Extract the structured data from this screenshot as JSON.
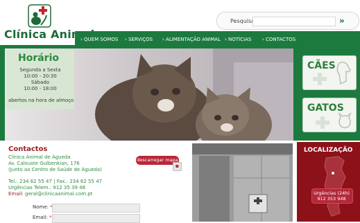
{
  "brand": {
    "name": "Clínica Animal"
  },
  "search": {
    "label": "Pesquisa",
    "go": "»"
  },
  "nav": {
    "items": [
      {
        "label": "› QUEM SOMOS"
      },
      {
        "label": "› SERVIÇOS"
      },
      {
        "label": "› ALIMENTAÇÃO ANIMAL"
      },
      {
        "label": "› NOTÍCIAS"
      },
      {
        "label": "› CONTACTOS"
      }
    ]
  },
  "horario": {
    "title": "Horário",
    "lines": [
      "Segunda a Sexta",
      "10:00 - 20:30",
      "Sábado",
      "10:00 - 18:00"
    ],
    "footer": "abertos na hora de almoço"
  },
  "side_buttons": {
    "caes": "CÃES",
    "gatos": "GATOS"
  },
  "contactos": {
    "title": "Contactos",
    "name": "Clínica Animal de Águeda",
    "address": "Av. Calouste Gulbenkian, 176",
    "near": "(Junto ao Centro de Saúde de Águeda)",
    "tel": "Tel.: 234 62 55 47 | Fax.: 234 62 55 47",
    "urgencias": "Urgências Telem.: 912 35 39 48",
    "email_label": "Email:",
    "email": "geral@clinicaanimal.com.pt",
    "download": "descarregar mapa"
  },
  "form": {
    "name_label": "Nome:",
    "email_label": "Email:",
    "required_mark": "*"
  },
  "localizacao": {
    "title": "LOCALIZAÇÃO",
    "urg_title": "Urgências (24h)",
    "urg_phone": "912 353 948"
  },
  "colors": {
    "brand_green": "#1c7a3f",
    "accent_red": "#9c1f22",
    "button_red": "#b9273a"
  }
}
